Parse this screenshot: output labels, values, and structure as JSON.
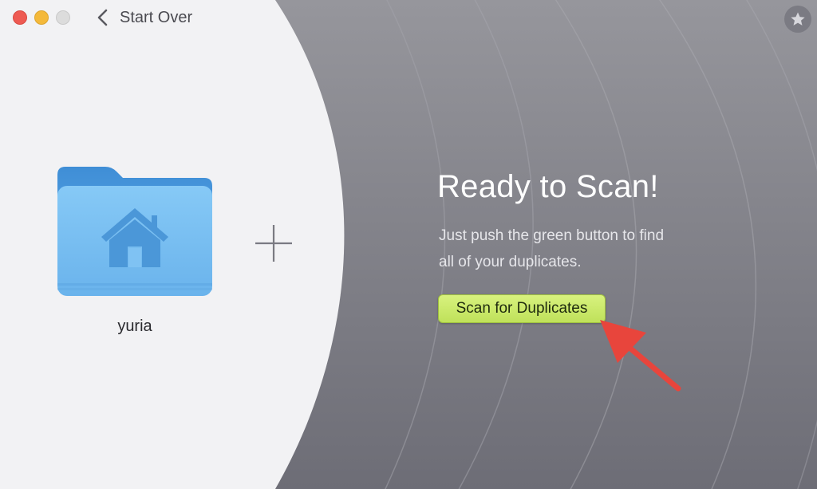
{
  "window": {
    "title_bar": {
      "back_label": "Start Over"
    }
  },
  "left": {
    "folder_name": "yuria"
  },
  "main": {
    "heading": "Ready to Scan!",
    "description_line1": "Just push the green button to find",
    "description_line2": "all of your duplicates.",
    "scan_button_label": "Scan for Duplicates"
  },
  "icons": [
    "close-icon",
    "minimize-icon",
    "zoom-icon",
    "chevron-left-icon",
    "star-icon",
    "home-folder-icon",
    "plus-icon",
    "arrow-annotation-icon"
  ],
  "colors": {
    "accent_green": "#c6e765",
    "annotation_red": "#e8453c",
    "folder_blue": "#6ab8ef"
  }
}
